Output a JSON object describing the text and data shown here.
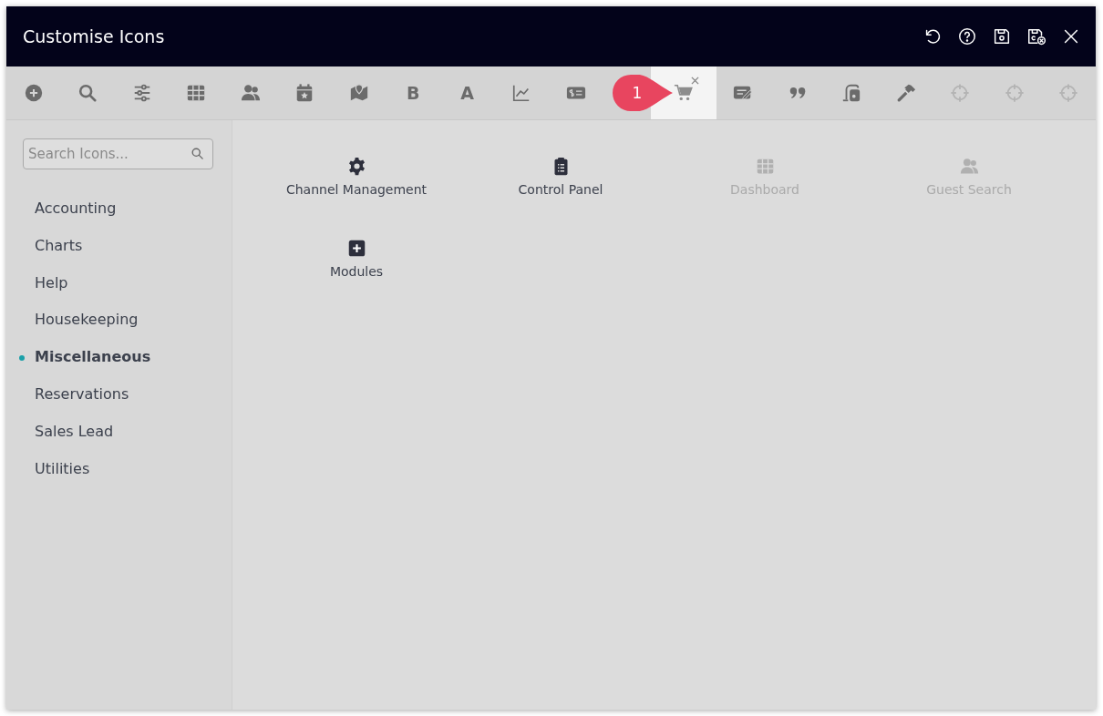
{
  "window": {
    "title": "Customise Icons",
    "actions": [
      {
        "kind": "undo"
      },
      {
        "kind": "help"
      },
      {
        "kind": "save"
      },
      {
        "kind": "save-close"
      },
      {
        "kind": "close"
      }
    ]
  },
  "toolbar": {
    "items": [
      {
        "kind": "plus-circle",
        "selected": false,
        "disabled": false
      },
      {
        "kind": "search",
        "selected": false,
        "disabled": false
      },
      {
        "kind": "sliders",
        "selected": false,
        "disabled": false
      },
      {
        "kind": "grid",
        "selected": false,
        "disabled": false
      },
      {
        "kind": "users",
        "selected": false,
        "disabled": false
      },
      {
        "kind": "calendar",
        "selected": false,
        "disabled": false
      },
      {
        "kind": "map",
        "selected": false,
        "disabled": false
      },
      {
        "kind": "glyph",
        "glyph": "B",
        "selected": false,
        "disabled": false
      },
      {
        "kind": "glyph",
        "glyph": "A",
        "selected": false,
        "disabled": false
      },
      {
        "kind": "chart",
        "selected": false,
        "disabled": false
      },
      {
        "kind": "money",
        "selected": false,
        "disabled": false
      },
      {
        "kind": "cart",
        "selected": true,
        "disabled": false
      },
      {
        "kind": "note",
        "selected": false,
        "disabled": false
      },
      {
        "kind": "quote",
        "selected": false,
        "disabled": false
      },
      {
        "kind": "vacuum",
        "selected": false,
        "disabled": false
      },
      {
        "kind": "hammer",
        "selected": false,
        "disabled": false
      },
      {
        "kind": "crosshair",
        "selected": false,
        "disabled": true
      },
      {
        "kind": "crosshair",
        "selected": false,
        "disabled": true
      },
      {
        "kind": "crosshair",
        "selected": false,
        "disabled": true
      }
    ],
    "callout": {
      "label": "1"
    }
  },
  "sidebar": {
    "search": {
      "placeholder": "Search Icons..."
    },
    "items": [
      {
        "label": "Accounting",
        "selected": false
      },
      {
        "label": "Charts",
        "selected": false
      },
      {
        "label": "Help",
        "selected": false
      },
      {
        "label": "Housekeeping",
        "selected": false
      },
      {
        "label": "Miscellaneous",
        "selected": true
      },
      {
        "label": "Reservations",
        "selected": false
      },
      {
        "label": "Sales Lead",
        "selected": false
      },
      {
        "label": "Utilities",
        "selected": false
      }
    ]
  },
  "icons": [
    {
      "kind": "gear",
      "label": "Channel Management",
      "disabled": false
    },
    {
      "kind": "clipboard",
      "label": "Control Panel",
      "disabled": false
    },
    {
      "kind": "grid",
      "label": "Dashboard",
      "disabled": true
    },
    {
      "kind": "users",
      "label": "Guest Search",
      "disabled": true
    },
    {
      "kind": "plus-square",
      "label": "Modules",
      "disabled": false
    }
  ]
}
